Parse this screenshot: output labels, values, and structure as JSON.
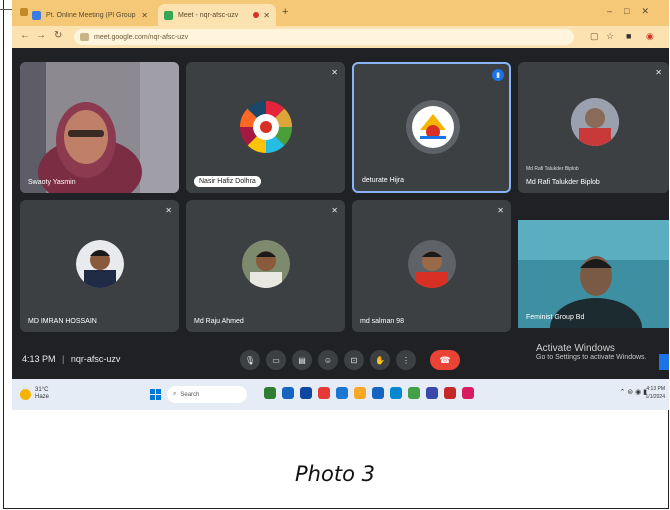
{
  "browser": {
    "tabs": [
      {
        "title": "Pt. Online Meeting (Pl Group Class)",
        "icon_color": "#3d7be0"
      },
      {
        "title": "Meet - nqr-afsc-uzv",
        "icon_color": "#34a853"
      }
    ],
    "url": "meet.google.com/nqr-afsc-uzv"
  },
  "participants": [
    {
      "name": "Swaoty Yasmin"
    },
    {
      "name": "Nasir Hafiz Dolhra"
    },
    {
      "name": "deturate Hijra"
    },
    {
      "name": "Md Rafi Talukder Biplob",
      "subtitle": "Md Rafi Talukder Biplob"
    },
    {
      "name": "MD IMRAN HOSSAIN"
    },
    {
      "name": "Md Raju Ahmed"
    },
    {
      "name": "md salman 98"
    },
    {
      "name": "Feminist Group Bd"
    }
  ],
  "meeting": {
    "time": "4:13 PM",
    "code": "nqr-afsc-uzv",
    "end_call_icon": "phone-hangup-icon"
  },
  "watermark": {
    "title": "Activate Windows",
    "subtitle": "Go to Settings to activate Windows."
  },
  "taskbar": {
    "weather_temp": "31°C",
    "weather_text": "Haze",
    "search_placeholder": "Search",
    "time": "4:13 PM",
    "date": "1/1/2024"
  },
  "caption": "Photo 3"
}
